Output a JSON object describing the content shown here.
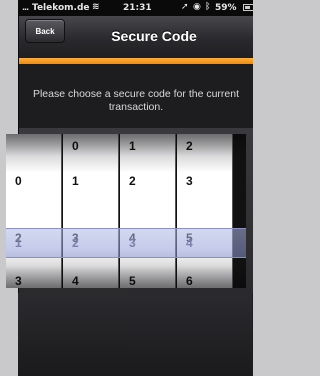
{
  "status_bar": {
    "signal": "...",
    "carrier": "Telekom.de",
    "time": "21:31",
    "battery": "59%"
  },
  "nav": {
    "back_label": "Back",
    "title": "Secure Code"
  },
  "prompt": "Please choose a secure code for the current transaction.",
  "picker": {
    "wheels": [
      {
        "rows": [
          "",
          "0",
          "1",
          "2",
          "3"
        ]
      },
      {
        "rows": [
          "0",
          "1",
          "2",
          "3",
          "4"
        ]
      },
      {
        "rows": [
          "1",
          "2",
          "3",
          "4",
          "5"
        ]
      },
      {
        "rows": [
          "2",
          "3",
          "4",
          "5",
          "6"
        ]
      }
    ],
    "selected_row_values": [
      "1",
      "2",
      "3",
      "4"
    ]
  }
}
